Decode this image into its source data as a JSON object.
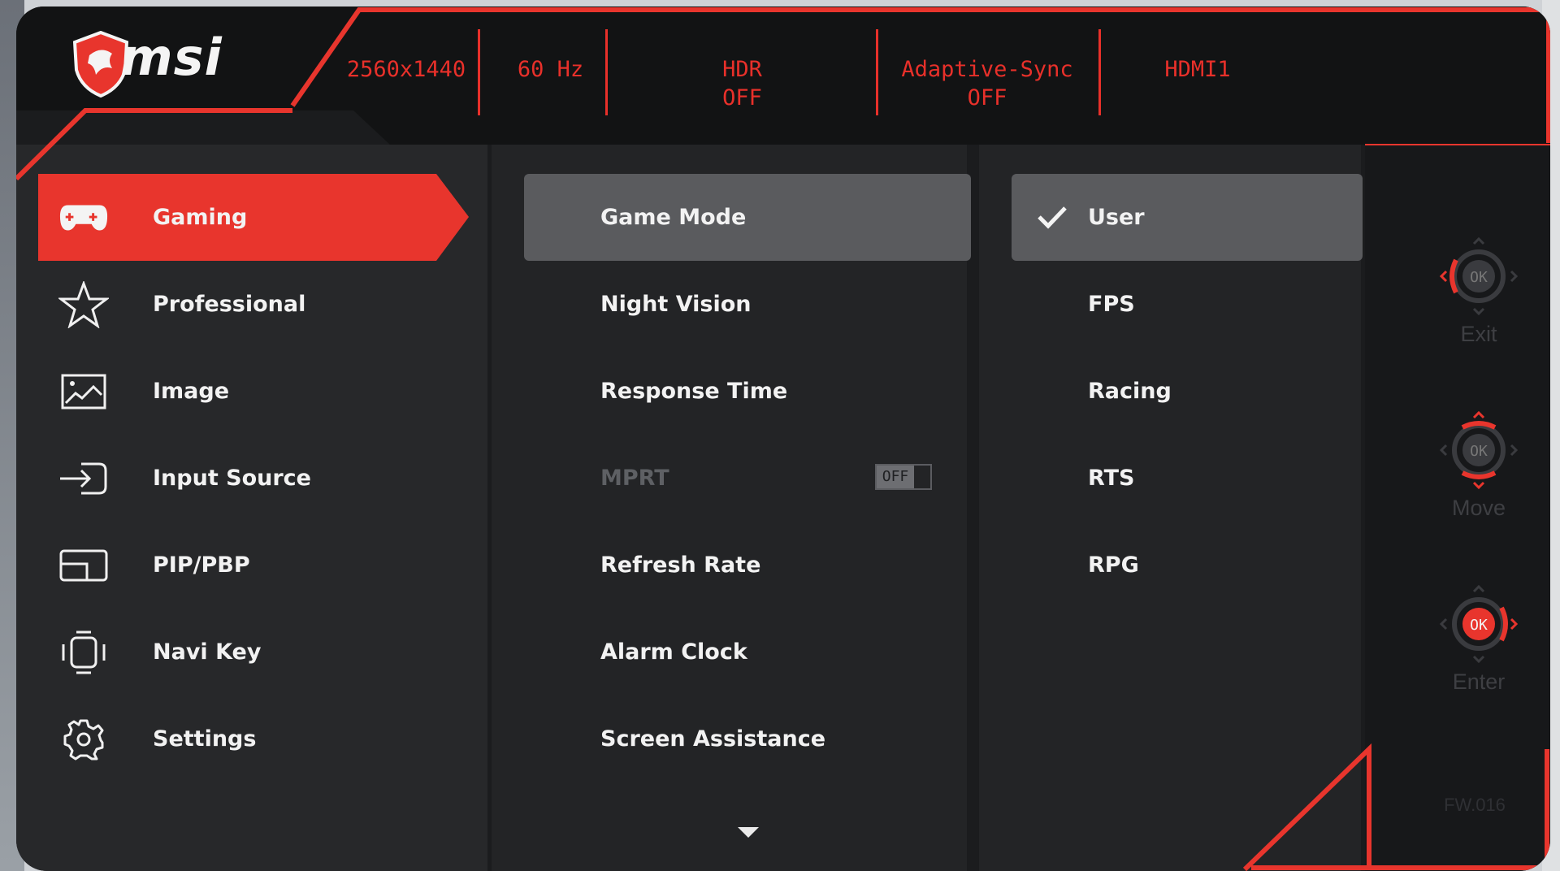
{
  "brand": {
    "logo_text": "msi"
  },
  "status_bar": {
    "resolution": "2560x1440",
    "refresh": "60 Hz",
    "hdr_line1": "HDR",
    "hdr_line2": "OFF",
    "adaptive_line1": "Adaptive-Sync",
    "adaptive_line2": "OFF",
    "input": "HDMI1"
  },
  "main_menu": {
    "items": [
      {
        "label": "Gaming",
        "icon": "gamepad-icon",
        "active": true
      },
      {
        "label": "Professional",
        "icon": "star-icon"
      },
      {
        "label": "Image",
        "icon": "image-icon"
      },
      {
        "label": "Input Source",
        "icon": "input-source-icon"
      },
      {
        "label": "PIP/PBP",
        "icon": "pip-icon"
      },
      {
        "label": "Navi Key",
        "icon": "navi-key-icon"
      },
      {
        "label": "Settings",
        "icon": "gear-icon"
      }
    ]
  },
  "sub_menu": {
    "items": [
      {
        "label": "Game Mode",
        "active": true
      },
      {
        "label": "Night Vision"
      },
      {
        "label": "Response Time"
      },
      {
        "label": "MPRT",
        "disabled": true,
        "toggle": "OFF"
      },
      {
        "label": "Refresh Rate"
      },
      {
        "label": "Alarm Clock"
      },
      {
        "label": "Screen Assistance"
      }
    ],
    "more_indicator": "chevron-down-icon"
  },
  "options": {
    "items": [
      {
        "label": "User",
        "selected": true
      },
      {
        "label": "FPS"
      },
      {
        "label": "Racing"
      },
      {
        "label": "RTS"
      },
      {
        "label": "RPG"
      }
    ]
  },
  "navi_keys": {
    "exit": {
      "label": "Exit",
      "center": "OK"
    },
    "move": {
      "label": "Move",
      "center": "OK"
    },
    "enter": {
      "label": "Enter",
      "center": "OK"
    }
  },
  "firmware": "FW.016",
  "colors": {
    "accent": "#e8352d",
    "panel": "#27282a",
    "highlight": "#5a5b5e"
  }
}
